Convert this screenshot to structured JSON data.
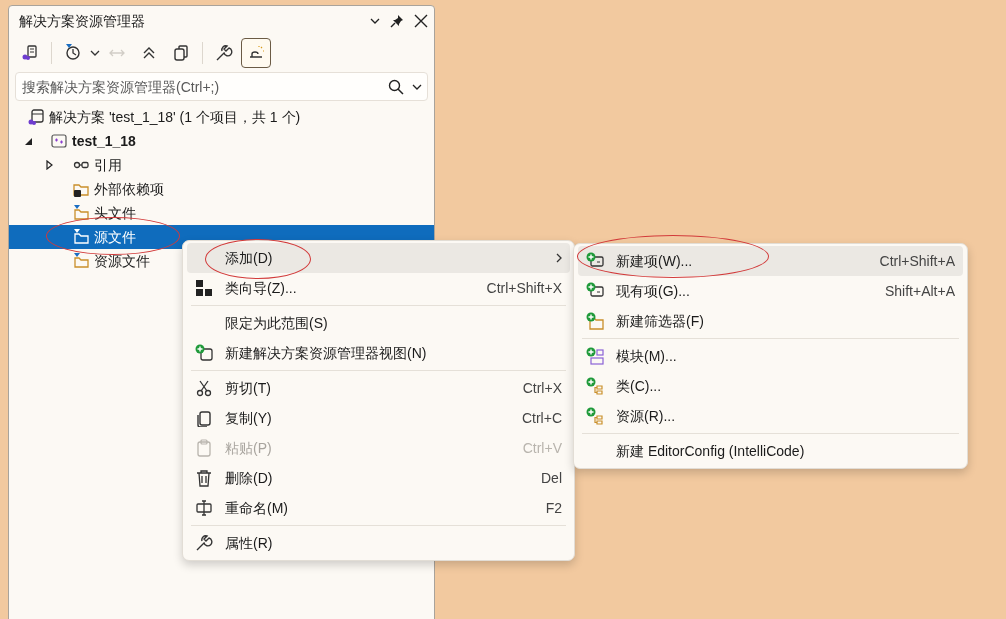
{
  "panel": {
    "title": "解决方案资源管理器"
  },
  "toolbar": [
    {
      "pressed": false,
      "disabled": false
    },
    {
      "pressed": false,
      "disabled": false
    },
    {
      "pressed": false,
      "disabled": true
    },
    {
      "pressed": false,
      "disabled": false
    },
    {
      "pressed": false,
      "disabled": false
    },
    {
      "pressed": false,
      "disabled": false
    },
    {
      "pressed": true,
      "disabled": false
    }
  ],
  "search": {
    "placeholder": "搜索解决方案资源管理器(Ctrl+;)"
  },
  "tree": [
    {
      "label": "解决方案 'test_1_18' (1 个项目，共 1 个)",
      "kind": "solution",
      "selected": false,
      "circled": false,
      "children": [
        {
          "label": "test_1_18",
          "kind": "project",
          "bold": true,
          "expanded": true,
          "selected": false,
          "circled": false,
          "children": [
            {
              "label": "引用",
              "kind": "references",
              "expanded": false,
              "selected": false,
              "circled": false
            },
            {
              "label": "外部依赖项",
              "kind": "external",
              "selected": false,
              "circled": false
            },
            {
              "label": "头文件",
              "kind": "filter",
              "selected": false,
              "circled": false
            },
            {
              "label": "源文件",
              "kind": "filter",
              "selected": true,
              "circled": true
            },
            {
              "label": "资源文件",
              "kind": "filter",
              "selected": false,
              "circled": false
            }
          ]
        }
      ]
    }
  ],
  "context_menu": [
    [
      {
        "label": "添加(D)",
        "submenu": true,
        "highlighted": true,
        "circled": true,
        "disabled": false
      },
      {
        "label": "类向导(Z)...",
        "shortcut": "Ctrl+Shift+X",
        "highlighted": false,
        "circled": false,
        "disabled": false
      }
    ],
    [
      {
        "label": "限定为此范围(S)",
        "highlighted": false,
        "circled": false,
        "disabled": false
      },
      {
        "label": "新建解决方案资源管理器视图(N)",
        "highlighted": false,
        "circled": false,
        "disabled": false
      }
    ],
    [
      {
        "label": "剪切(T)",
        "shortcut": "Ctrl+X",
        "highlighted": false,
        "circled": false,
        "disabled": false
      },
      {
        "label": "复制(Y)",
        "shortcut": "Ctrl+C",
        "highlighted": false,
        "circled": false,
        "disabled": false
      },
      {
        "label": "粘贴(P)",
        "shortcut": "Ctrl+V",
        "highlighted": false,
        "circled": false,
        "disabled": true
      },
      {
        "label": "删除(D)",
        "shortcut": "Del",
        "highlighted": false,
        "circled": false,
        "disabled": false
      },
      {
        "label": "重命名(M)",
        "shortcut": "F2",
        "highlighted": false,
        "circled": false,
        "disabled": false
      }
    ],
    [
      {
        "label": "属性(R)",
        "highlighted": false,
        "circled": false,
        "disabled": false
      }
    ]
  ],
  "submenu": [
    [
      {
        "label": "新建项(W)...",
        "shortcut": "Ctrl+Shift+A",
        "highlighted": true,
        "circled": true,
        "disabled": false
      },
      {
        "label": "现有项(G)...",
        "shortcut": "Shift+Alt+A",
        "highlighted": false,
        "circled": false,
        "disabled": false
      },
      {
        "label": "新建筛选器(F)",
        "highlighted": false,
        "circled": false,
        "disabled": false
      }
    ],
    [
      {
        "label": "模块(M)...",
        "highlighted": false,
        "circled": false,
        "disabled": false
      },
      {
        "label": "类(C)...",
        "highlighted": false,
        "circled": false,
        "disabled": false
      },
      {
        "label": "资源(R)...",
        "highlighted": false,
        "circled": false,
        "disabled": false
      }
    ],
    [
      {
        "label": "新建 EditorConfig (IntelliCode)",
        "highlighted": false,
        "circled": false,
        "disabled": false
      }
    ]
  ]
}
